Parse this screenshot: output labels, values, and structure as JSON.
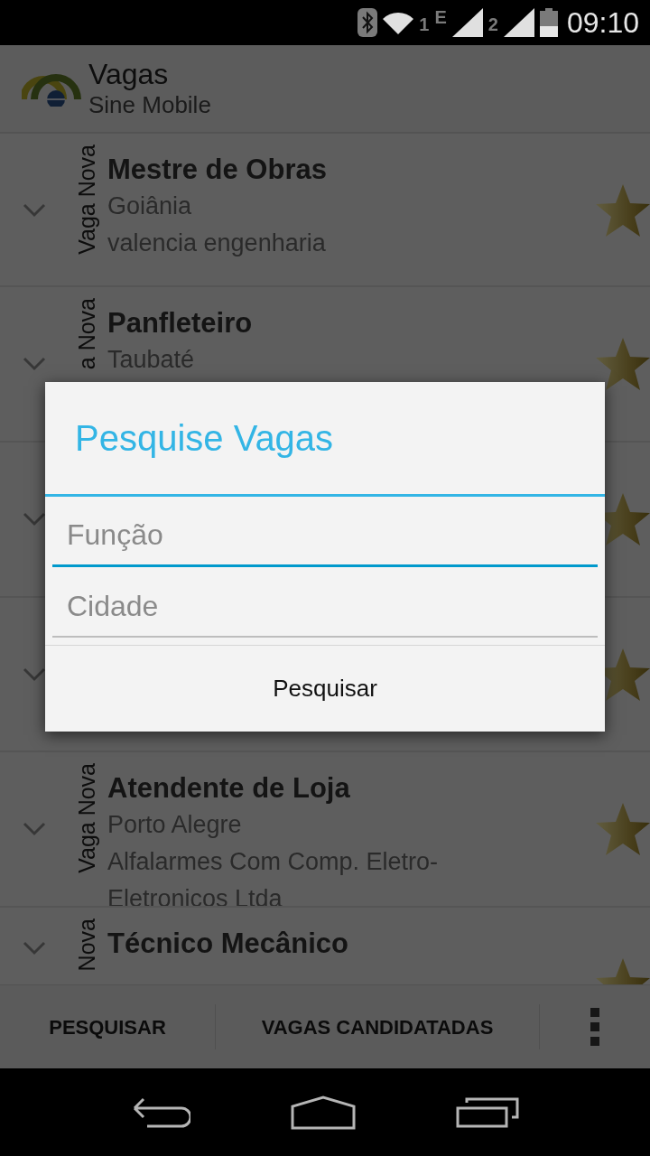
{
  "status_bar": {
    "wifi_sim": "1",
    "network_type": "E",
    "sim_2": "2",
    "time": "09:10"
  },
  "action_bar": {
    "title": "Vagas",
    "subtitle": "Sine Mobile"
  },
  "jobs": [
    {
      "kind": "job",
      "tag": "Vaga Nova",
      "title": "Mestre de Obras",
      "city": "Goiânia",
      "company": "valencia engenharia"
    },
    {
      "kind": "job",
      "tag": "a Nova",
      "title": "Panfleteiro",
      "city": "Taubaté"
    },
    {
      "kind": "covered"
    },
    {
      "kind": "covered"
    },
    {
      "kind": "job",
      "tag": "Vaga Nova",
      "title": "Atendente de Loja",
      "city": "Porto Alegre",
      "company": "Alfalarmes Com Comp. Eletro-Eletronicos Ltda"
    },
    {
      "kind": "job",
      "tag": "Nova",
      "title": "Técnico Mecânico"
    }
  ],
  "dialog": {
    "title": "Pesquise Vagas",
    "fields": [
      {
        "placeholder": "Função",
        "focused": true
      },
      {
        "placeholder": "Cidade",
        "focused": false
      }
    ],
    "button": "Pesquisar"
  },
  "bottom_bar": {
    "actions": [
      "PESQUISAR",
      "VAGAS CANDIDATADAS"
    ]
  }
}
